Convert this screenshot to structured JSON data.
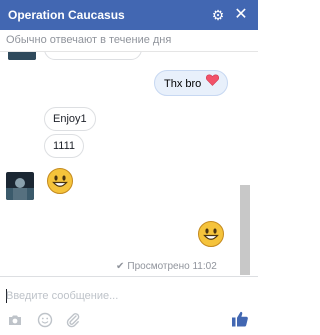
{
  "header": {
    "title": "Operation Caucasus",
    "settings_icon": "gear-icon",
    "close_icon": "close-icon"
  },
  "status": {
    "text": "Обычно отвечают в течение дня"
  },
  "messages": [
    {
      "side": "out",
      "text": "Thx bro",
      "emoji": "heart"
    },
    {
      "side": "in",
      "text": "Enjoy1"
    },
    {
      "side": "in",
      "text": "1111"
    },
    {
      "side": "in",
      "emoji": "smile"
    },
    {
      "side": "out",
      "emoji": "smile"
    }
  ],
  "receipt": {
    "text": "Просмотрено 11:02"
  },
  "composer": {
    "placeholder": "Введите сообщение...",
    "tools": [
      "camera-icon",
      "emoji-icon",
      "attach-icon"
    ],
    "like_icon": "thumbs-up-icon"
  },
  "colors": {
    "header": "#4267b2",
    "like": "#4267b2",
    "heart": "#f25268",
    "emoji": "#f5c33b"
  }
}
